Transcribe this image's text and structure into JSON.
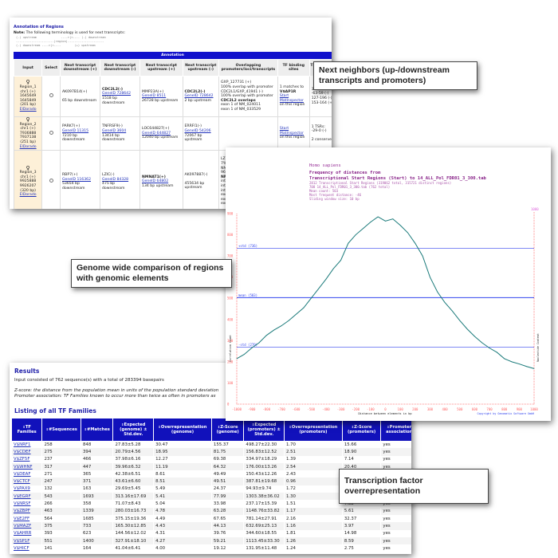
{
  "annotation": {
    "title": "Annotation of Regions",
    "note_label": "Note:",
    "note": "The following terminology is used for next transcripts:",
    "terminology": "(-) upstream              ---->|<---- (-) downstream\n----------------------|region|---------------------\n(-) downstream ---->|<----        (+) upstream",
    "bar": "Annotation",
    "headers": [
      "Input",
      "Select",
      "Next transcript downstream (+)",
      "Next transcript downstream (-)",
      "Next transcript upstream (+)",
      "Next transcript upstream (-)",
      "Overlapping promoters/loci/transcripts",
      "TF binding sites",
      "TSRs, repeats, conserved regions, microRNA"
    ],
    "rows": [
      {
        "input": [
          "Region_1",
          "chr1 (+)",
          "1645649",
          "1645849",
          "(201 bp)"
        ],
        "link": "ElDorado",
        "c1": [
          "AK097B14(+)",
          "",
          "65 bp downstream"
        ],
        "c2": [
          "CDC2L2(-)",
          "GeneID 728642",
          "1518 bp downstream"
        ],
        "c3": [
          "MMP23A(+)",
          "GeneID 8511",
          "26728 bp upstream"
        ],
        "c4": [
          "CDC2L2(-)",
          "GeneID 728642",
          "2 bp upstream"
        ],
        "c5": [
          "GXP_127731 (+)",
          "100% overlap with promoter",
          "CDC2L1/GXP_41941 (-)",
          "100% overlap with promoter",
          "CDC2L2 overlaps",
          "exon 1 of NM_024011",
          "exon 1 of NM_033529"
        ],
        "c6": [
          "1 matches to",
          "V$AP1R",
          "Start MatInspector",
          "on this region"
        ],
        "c7": [
          "3 TSRs:",
          "-63-59 (-)",
          "127-196 (-)",
          "153-164 (+)"
        ]
      },
      {
        "input": [
          "Region_2",
          "chr1 (+)",
          "7936888",
          "7937138",
          "(251 bp)"
        ],
        "link": "ElDorado",
        "c1": [
          "PARK7(+)",
          "GeneID 11315",
          "7210 bp downstream"
        ],
        "c2": [
          "TNFRSF9(-)",
          "GeneID 3604",
          "13414 bp downstream"
        ],
        "c3": [
          "LOC644827(+)",
          "GeneID 644827",
          "12040 bp upstream"
        ],
        "c4": [
          "ERRFI1(-)",
          "GeneID 54206",
          "72067 bp upstream"
        ],
        "c5": [],
        "c6": [
          "Start MatInspector",
          "on this region"
        ],
        "c7": [
          "1 TSRs:",
          "-29-0 (-)",
          "",
          "2 conserved regions"
        ]
      },
      {
        "input": [
          "Region_3",
          "chr1 (+)",
          "9925888",
          "9926207",
          "(320 bp)"
        ],
        "link": "ElDorado",
        "c1": [
          "RBP7(+)",
          "GeneID 116362",
          "53654 bp downstream"
        ],
        "c2": [
          "LZIC(-)",
          "GeneID 84328",
          "475 bp downstream"
        ],
        "c3": [
          "NMNAT1(+)",
          "GeneID 64802",
          "134 bp upstream"
        ],
        "c4": [
          "AK097887(-)",
          "",
          "455634 bp upstream"
        ],
        "c5": [
          "LZIC/GXP_41951 (-)",
          "7% overlap with promoter",
          "NMNAT1/GXP_7117",
          "96% overlap with promoter",
          "NMNAT1 overlaps",
          "intron 1 of NM_0227",
          "intron 1 of AK2229",
          "intron 1 of AK0260",
          "exon 1 of NM_0227",
          "exon 1 of AK2229",
          "exon 1 of AK0260"
        ],
        "c6": [],
        "c7": []
      }
    ]
  },
  "chart": {
    "species": "Homo sapiens",
    "title1": "Frequency of distances from",
    "title2": "Transcriptional Start Regions (Start) to 14_ALL_Pol_FDR01_3_300.tab",
    "info": [
      "2812 Transcriptional Start Regions (319062 total, 315721 distinct regions)",
      "708 14_ALL_Pol_FDR01_3_300.tab (762 total)",
      "Mean count: 503",
      "Most frequent distance: -46",
      "Sliding window size: 10 bp"
    ],
    "ylabel": "Correlation Count",
    "y2label": "Nucleotide Content",
    "xlabel": "Distance between elements in bp",
    "copyright": "Copyright by Genomatix Software GmbH",
    "lines": [
      {
        "label": "+std (736)",
        "value": 736
      },
      {
        "label": "mean (503)",
        "value": 503
      },
      {
        "label": "-std (270)",
        "value": 270
      }
    ],
    "colors": {
      "curve": "#1a7a7a",
      "axis": "#ff6666",
      "lines": "#3344ee"
    }
  },
  "chart_data": {
    "type": "line",
    "xlim": [
      -1000,
      1000
    ],
    "ylim": [
      0,
      900
    ],
    "y2lim": [
      0,
      1000
    ],
    "xticks": [
      -1000,
      -900,
      -800,
      -700,
      -600,
      -500,
      -400,
      -300,
      -200,
      -100,
      0,
      100,
      200,
      300,
      400,
      500,
      600,
      700,
      800,
      900,
      1000
    ],
    "yticks": [
      0,
      100,
      200,
      300,
      400,
      500,
      600,
      700,
      800,
      900
    ],
    "x": [
      -1000,
      -950,
      -900,
      -850,
      -800,
      -750,
      -700,
      -650,
      -600,
      -550,
      -500,
      -450,
      -400,
      -350,
      -300,
      -250,
      -200,
      -150,
      -100,
      -50,
      0,
      50,
      100,
      150,
      200,
      250,
      300,
      350,
      400,
      450,
      500,
      550,
      600,
      650,
      700,
      750,
      800,
      850,
      900,
      950,
      1000
    ],
    "y": [
      215,
      235,
      265,
      290,
      325,
      350,
      370,
      395,
      425,
      455,
      500,
      545,
      590,
      640,
      680,
      760,
      800,
      830,
      860,
      885,
      865,
      875,
      845,
      810,
      760,
      700,
      600,
      530,
      480,
      440,
      395,
      355,
      320,
      290,
      265,
      245,
      215,
      200,
      190,
      178,
      168
    ]
  },
  "results": {
    "title": "Results",
    "input": "Input consisted of 762 sequence(s) with a total of 283394 basepairs",
    "zscore": "Z-score: the distance from the population mean in units of the population standard deviation",
    "promoter": "Promoter association: TF Families known to occur more than twice as often in promoters as",
    "listing": "Listing of all TF Families",
    "headers": [
      "TF Families",
      "#Sequences",
      "#Matches",
      "Expected (genome) ± Std.dev.",
      "Overrepresentation (genome)",
      "Z-Score (genome)",
      "Expected (promoters) ± Std.dev.",
      "Overrepresentation (promoters)",
      "Z-Score (promoters)",
      "Promoter association"
    ],
    "rows": [
      [
        "V$NRF1",
        "258",
        "848",
        "27.83±5.28",
        "30.47",
        "155.37",
        "498.27±22.30",
        "1.70",
        "15.66",
        "yes"
      ],
      [
        "V$CDEF",
        "275",
        "394",
        "20.79±4.56",
        "18.95",
        "81.75",
        "156.83±12.52",
        "2.51",
        "18.90",
        "yes"
      ],
      [
        "V$ZF5F",
        "237",
        "466",
        "37.98±6.16",
        "12.27",
        "69.38",
        "334.97±18.29",
        "1.39",
        "7.14",
        "yes"
      ],
      [
        "V$WHNF",
        "317",
        "447",
        "39.96±6.32",
        "11.19",
        "64.32",
        "176.00±13.26",
        "2.54",
        "20.40",
        "yes"
      ],
      [
        "V$DEAF",
        "271",
        "365",
        "42.38±6.51",
        "8.61",
        "49.49",
        "150.43±12.26",
        "2.43",
        "17",
        "yes"
      ],
      [
        "V$CTCF",
        "247",
        "371",
        "43.61±6.60",
        "8.51",
        "49.51",
        "387.81±19.68",
        "0.96",
        "-0",
        "yes"
      ],
      [
        "V$PAX9",
        "132",
        "163",
        "29.69±5.45",
        "5.49",
        "24.37",
        "94.93±9.74",
        "1.72",
        "6.5",
        "yes"
      ],
      [
        "V$EGRF",
        "543",
        "1693",
        "313.16±17.69",
        "5.41",
        "77.99",
        "1303.38±36.02",
        "1.30",
        "10.80",
        "yes"
      ],
      [
        "V$NRSF",
        "266",
        "358",
        "71.07±8.43",
        "5.04",
        "33.98",
        "237.17±15.39",
        "1.51",
        "7.82",
        "yes"
      ],
      [
        "V$ZBPF",
        "463",
        "1339",
        "280.03±16.73",
        "4.78",
        "63.28",
        "1148.76±33.82",
        "1.17",
        "5.61",
        "yes"
      ],
      [
        "V$E2FF",
        "564",
        "1685",
        "375.15±19.36",
        "4.49",
        "67.65",
        "781.14±27.91",
        "2.16",
        "32.37",
        "yes"
      ],
      [
        "V$MAZF",
        "375",
        "733",
        "165.30±12.85",
        "4.43",
        "44.13",
        "632.69±25.13",
        "1.16",
        "3.97",
        "yes"
      ],
      [
        "V$AHRR",
        "393",
        "623",
        "144.56±12.02",
        "4.31",
        "39.76",
        "344.60±18.55",
        "1.81",
        "14.98",
        "yes"
      ],
      [
        "V$SP1F",
        "551",
        "1400",
        "327.91±18.10",
        "4.27",
        "59.21",
        "1113.45±33.30",
        "1.26",
        "8.59",
        "yes"
      ],
      [
        "V$HICF",
        "141",
        "164",
        "41.04±6.41",
        "4.00",
        "19.12",
        "131.95±11.48",
        "1.24",
        "2.75",
        "yes"
      ]
    ]
  },
  "callouts": {
    "neighbors": "Next neighbors (up-/downstream transcripts and promoters)",
    "genome": "Genome wide comparison of regions with genomic elements",
    "tf": "Transcription factor overrepresentation"
  }
}
